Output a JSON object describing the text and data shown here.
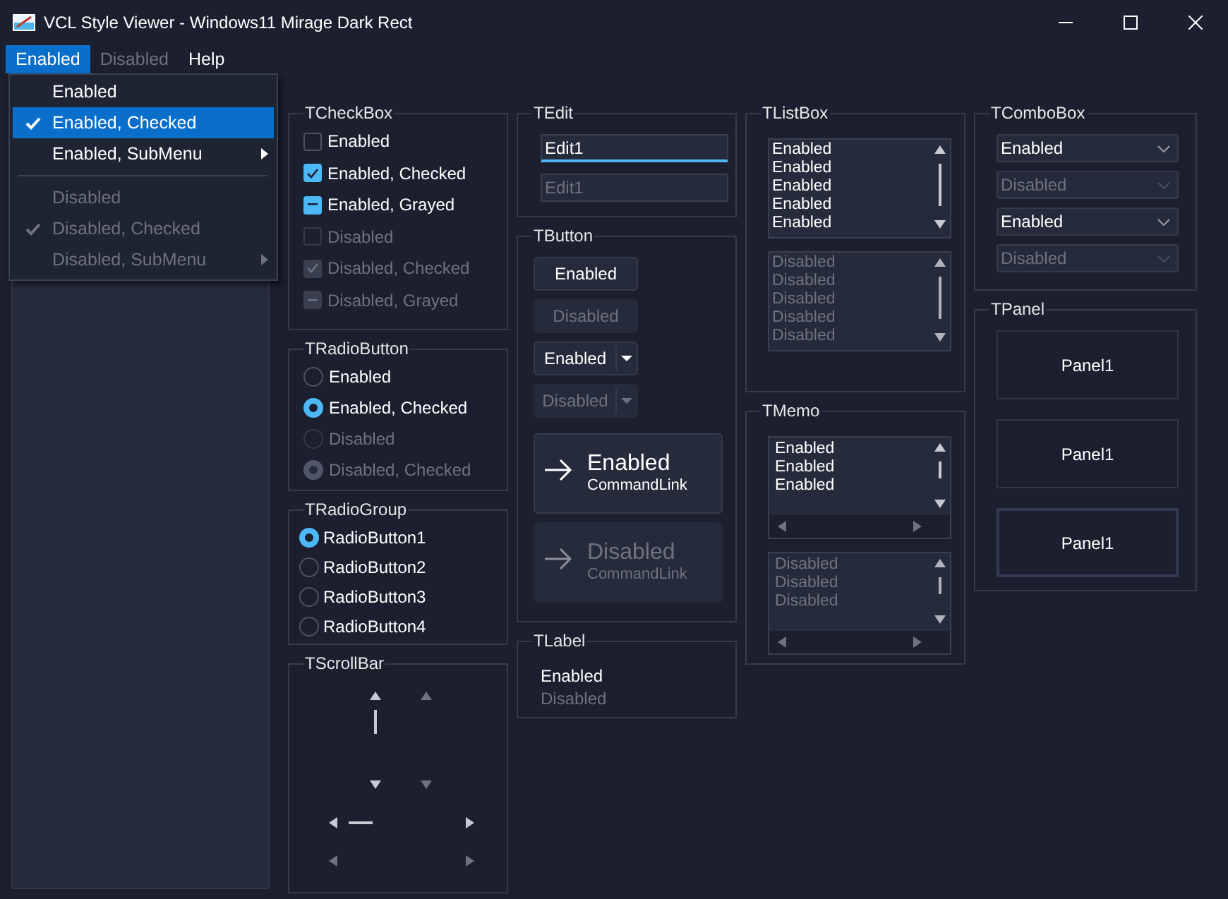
{
  "window": {
    "title": "VCL Style Viewer - Windows11 Mirage Dark Rect"
  },
  "menu_bar": [
    {
      "label": "Enabled",
      "selected": true,
      "disabled": false
    },
    {
      "label": "Disabled",
      "selected": false,
      "disabled": true
    },
    {
      "label": "Help",
      "selected": false,
      "disabled": false
    }
  ],
  "menu_dropdown": [
    {
      "kind": "item",
      "label": "Enabled",
      "checked": false,
      "disabled": false,
      "selected": false,
      "submenu": false
    },
    {
      "kind": "item",
      "label": "Enabled, Checked",
      "checked": true,
      "disabled": false,
      "selected": true,
      "submenu": false
    },
    {
      "kind": "item",
      "label": "Enabled, SubMenu",
      "checked": false,
      "disabled": false,
      "selected": false,
      "submenu": true
    },
    {
      "kind": "separator"
    },
    {
      "kind": "item",
      "label": "Disabled",
      "checked": false,
      "disabled": true,
      "selected": false,
      "submenu": false
    },
    {
      "kind": "item",
      "label": "Disabled, Checked",
      "checked": true,
      "disabled": true,
      "selected": false,
      "submenu": false
    },
    {
      "kind": "item",
      "label": "Disabled, SubMenu",
      "checked": false,
      "disabled": true,
      "selected": false,
      "submenu": true
    }
  ],
  "checkbox_group": {
    "title": "TCheckBox",
    "items": [
      {
        "label": "Enabled",
        "checked": false,
        "grayed": false,
        "disabled": false
      },
      {
        "label": "Enabled, Checked",
        "checked": true,
        "grayed": false,
        "disabled": false
      },
      {
        "label": "Enabled, Grayed",
        "checked": false,
        "grayed": true,
        "disabled": false
      },
      {
        "label": "Disabled",
        "checked": false,
        "grayed": false,
        "disabled": true
      },
      {
        "label": "Disabled, Checked",
        "checked": true,
        "grayed": false,
        "disabled": true
      },
      {
        "label": "Disabled, Grayed",
        "checked": false,
        "grayed": true,
        "disabled": true
      }
    ]
  },
  "radio_button_group": {
    "title": "TRadioButton",
    "items": [
      {
        "label": "Enabled",
        "checked": false,
        "disabled": false
      },
      {
        "label": "Enabled, Checked",
        "checked": true,
        "disabled": false
      },
      {
        "label": "Disabled",
        "checked": false,
        "disabled": true
      },
      {
        "label": "Disabled, Checked",
        "checked": true,
        "disabled": true
      }
    ]
  },
  "radio_group": {
    "title": "TRadioGroup",
    "items": [
      {
        "label": "RadioButton1",
        "selected": true
      },
      {
        "label": "RadioButton2",
        "selected": false
      },
      {
        "label": "RadioButton3",
        "selected": false
      },
      {
        "label": "RadioButton4",
        "selected": false
      }
    ]
  },
  "scrollbar_group": {
    "title": "TScrollBar"
  },
  "edit_group": {
    "title": "TEdit",
    "fields": [
      {
        "value": "Edit1",
        "disabled": false,
        "focused": true
      },
      {
        "value": "Edit1",
        "disabled": true,
        "focused": false
      }
    ]
  },
  "button_group": {
    "title": "TButton",
    "buttons": [
      {
        "kind": "push",
        "label": "Enabled",
        "disabled": false
      },
      {
        "kind": "push",
        "label": "Disabled",
        "disabled": true
      },
      {
        "kind": "split",
        "label": "Enabled",
        "disabled": false
      },
      {
        "kind": "split",
        "label": "Disabled",
        "disabled": true
      },
      {
        "kind": "command_link",
        "label": "Enabled",
        "note": "CommandLink",
        "disabled": false
      },
      {
        "kind": "command_link",
        "label": "Disabled",
        "note": "CommandLink",
        "disabled": true
      }
    ]
  },
  "label_group": {
    "title": "TLabel",
    "labels": [
      {
        "text": "Enabled",
        "disabled": false
      },
      {
        "text": "Disabled",
        "disabled": true
      }
    ]
  },
  "listbox_group": {
    "title": "TListBox",
    "listboxes": [
      {
        "disabled": false,
        "items": [
          "Enabled",
          "Enabled",
          "Enabled",
          "Enabled",
          "Enabled"
        ]
      },
      {
        "disabled": true,
        "items": [
          "Disabled",
          "Disabled",
          "Disabled",
          "Disabled",
          "Disabled"
        ]
      }
    ]
  },
  "memo_group": {
    "title": "TMemo",
    "memos": [
      {
        "disabled": false,
        "lines": [
          "Enabled",
          "Enabled",
          "Enabled"
        ]
      },
      {
        "disabled": true,
        "lines": [
          "Disabled",
          "Disabled",
          "Disabled"
        ]
      }
    ]
  },
  "combobox_group": {
    "title": "TComboBox",
    "comboboxes": [
      {
        "value": "Enabled",
        "disabled": false
      },
      {
        "value": "Disabled",
        "disabled": true
      },
      {
        "value": "Enabled",
        "disabled": false
      },
      {
        "value": "Disabled",
        "disabled": true
      }
    ]
  },
  "panel_group": {
    "title": "TPanel",
    "panels": [
      {
        "caption": "Panel1",
        "kind": "flat"
      },
      {
        "caption": "Panel1",
        "kind": "flat"
      },
      {
        "caption": "Panel1",
        "kind": "raised"
      }
    ]
  }
}
